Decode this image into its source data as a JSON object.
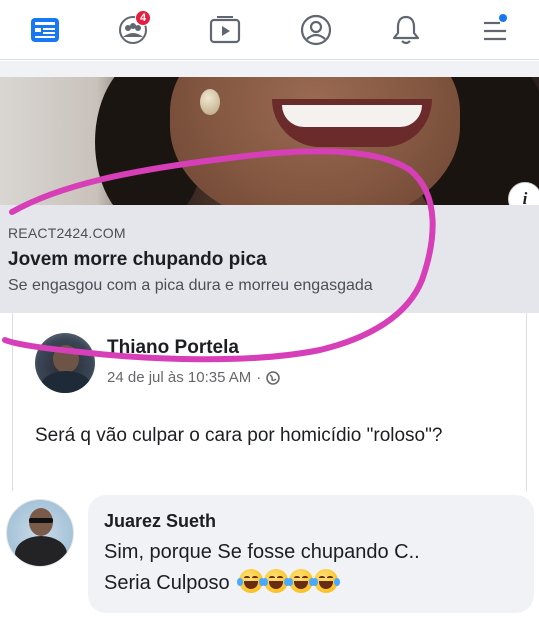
{
  "nav": {
    "items": [
      {
        "name": "home-icon"
      },
      {
        "name": "groups-icon",
        "badge": "4"
      },
      {
        "name": "watch-icon"
      },
      {
        "name": "profile-icon"
      },
      {
        "name": "notifications-icon"
      },
      {
        "name": "menu-icon"
      }
    ],
    "active_color": "#1877f2"
  },
  "shared_link": {
    "domain": "REACT2424.COM",
    "title": "Jovem morre chupando pica",
    "description": "Se engasgou com a pica dura e morreu engasgada",
    "info_icon": "i"
  },
  "post": {
    "author": "Thiano Portela",
    "timestamp": "24 de jul às 10:35 AM",
    "separator": "·",
    "text": "Será q vão culpar o cara por homicídio \"roloso\"?"
  },
  "comment": {
    "author": "Juarez Sueth",
    "line1": "Sim, porque Se fosse chupando C..",
    "line2": "Seria Culposo",
    "emojis": [
      "face-with-tears-of-joy",
      "face-with-tears-of-joy",
      "face-with-tears-of-joy",
      "face-with-tears-of-joy"
    ]
  },
  "colors": {
    "annotation_pink": "#d63fb7",
    "link_box_bg": "#e4e6eb",
    "badge_red": "#e41e3f"
  }
}
